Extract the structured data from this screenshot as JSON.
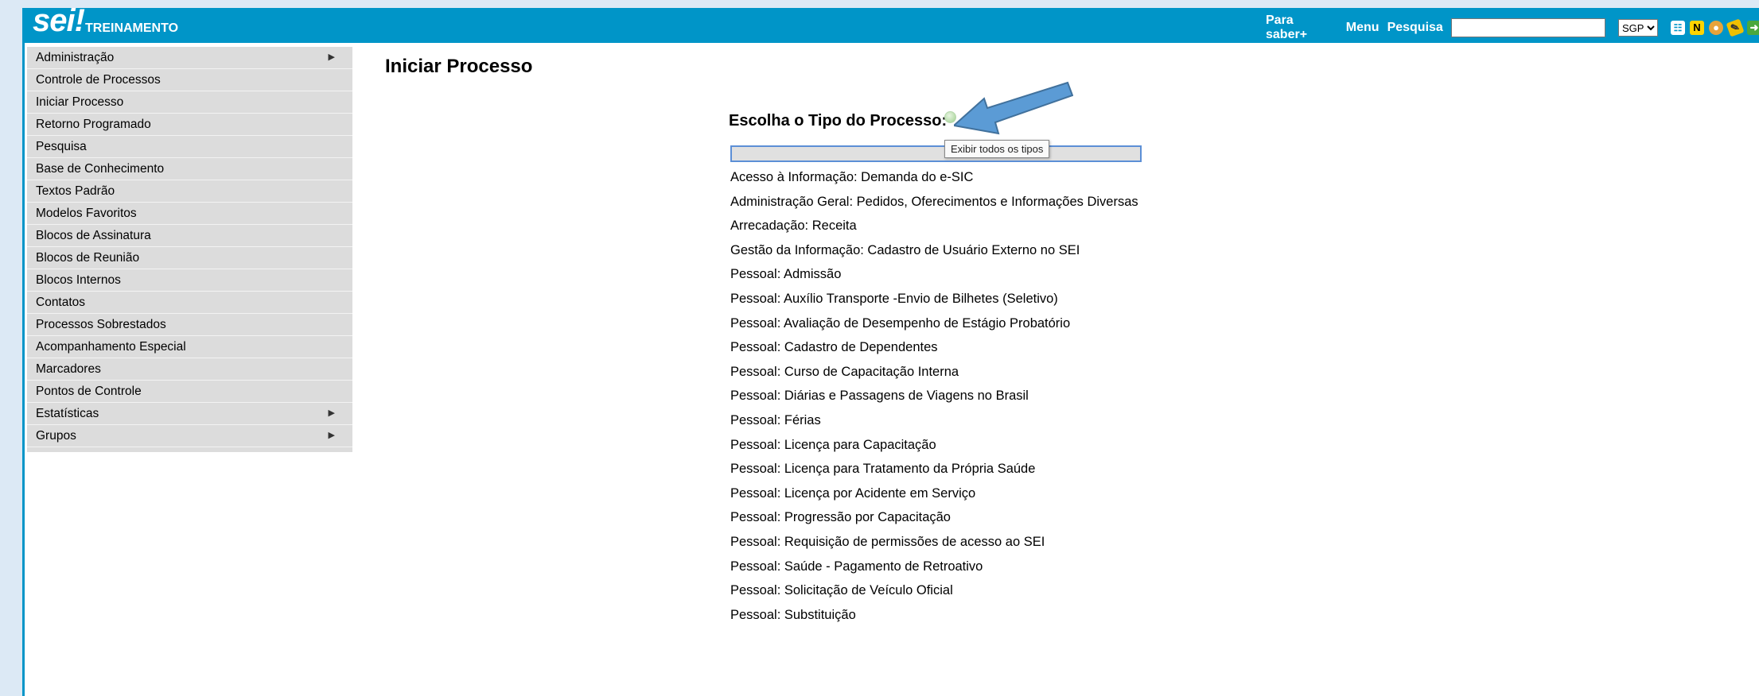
{
  "header": {
    "logo": "sei!",
    "env_name": "TREINAMENTO",
    "links": [
      "Para saber+",
      "Menu",
      "Pesquisa"
    ],
    "search": {
      "value": "",
      "placeholder": ""
    },
    "unit_select": "SGP",
    "icons": [
      "list-icon",
      "notes-icon",
      "user-icon",
      "tools-icon",
      "exit-icon"
    ]
  },
  "sidebar": {
    "items": [
      {
        "label": "Administração",
        "has_submenu": true
      },
      {
        "label": "Controle de Processos",
        "has_submenu": false
      },
      {
        "label": "Iniciar Processo",
        "has_submenu": false
      },
      {
        "label": "Retorno Programado",
        "has_submenu": false
      },
      {
        "label": "Pesquisa",
        "has_submenu": false
      },
      {
        "label": "Base de Conhecimento",
        "has_submenu": false
      },
      {
        "label": "Textos Padrão",
        "has_submenu": false
      },
      {
        "label": "Modelos Favoritos",
        "has_submenu": false
      },
      {
        "label": "Blocos de Assinatura",
        "has_submenu": false
      },
      {
        "label": "Blocos de Reunião",
        "has_submenu": false
      },
      {
        "label": "Blocos Internos",
        "has_submenu": false
      },
      {
        "label": "Contatos",
        "has_submenu": false
      },
      {
        "label": "Processos Sobrestados",
        "has_submenu": false
      },
      {
        "label": "Acompanhamento Especial",
        "has_submenu": false
      },
      {
        "label": "Marcadores",
        "has_submenu": false
      },
      {
        "label": "Pontos de Controle",
        "has_submenu": false
      },
      {
        "label": "Estatísticas",
        "has_submenu": true
      },
      {
        "label": "Grupos",
        "has_submenu": true
      }
    ]
  },
  "main": {
    "title": "Iniciar Processo",
    "chooser_label": "Escolha o Tipo do Processo:",
    "tooltip": "Exibir todos os tipos",
    "filter": {
      "value": ""
    },
    "types": [
      "Acesso à Informação: Demanda do e-SIC",
      "Administração Geral: Pedidos, Oferecimentos e Informações Diversas",
      "Arrecadação: Receita",
      "Gestão da Informação: Cadastro de Usuário Externo no SEI",
      "Pessoal: Admissão",
      "Pessoal: Auxílio Transporte -Envio de Bilhetes (Seletivo)",
      "Pessoal: Avaliação de Desempenho de Estágio Probatório",
      "Pessoal: Cadastro de Dependentes",
      "Pessoal: Curso de Capacitação Interna",
      "Pessoal: Diárias e Passagens de Viagens no Brasil",
      "Pessoal: Férias",
      "Pessoal: Licença para Capacitação",
      "Pessoal: Licença para Tratamento da Própria Saúde",
      "Pessoal: Licença por Acidente em Serviço",
      "Pessoal: Progressão por Capacitação",
      "Pessoal: Requisição de permissões de acesso ao SEI",
      "Pessoal: Saúde - Pagamento de Retroativo",
      "Pessoal: Solicitação de Veículo Oficial",
      "Pessoal: Substituição"
    ]
  },
  "colors": {
    "header_bg": "#0095c8",
    "sidebar_bg": "#dcdcdc",
    "annotation_arrow": "#5b9bd5"
  }
}
